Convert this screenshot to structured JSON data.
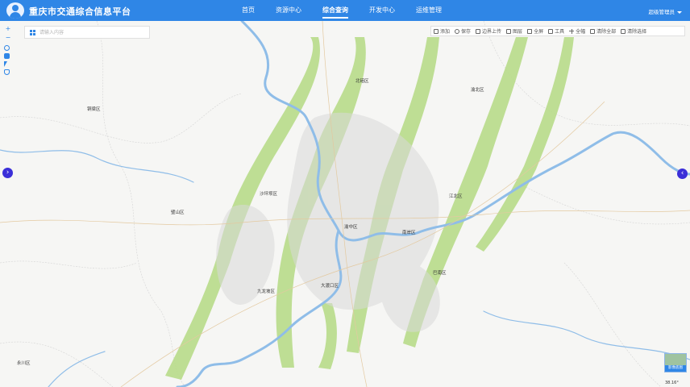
{
  "header": {
    "app_title": "重庆市交通综合信息平台",
    "nav": [
      "首页",
      "资源中心",
      "综合查询",
      "开发中心",
      "运维管理"
    ],
    "active_nav_index": 2,
    "user_label": "超级管理员",
    "bg_color": "#2f86e6"
  },
  "search": {
    "placeholder": "请输入内容",
    "icon": "grid-icon"
  },
  "map_controls": {
    "zoom_in": "+",
    "zoom_out": "−"
  },
  "toolbar": {
    "items": [
      {
        "label": "添加",
        "icon": "add-layer-icon"
      },
      {
        "label": "保存",
        "icon": "save-icon"
      },
      {
        "label": "边界上传",
        "icon": "upload-icon"
      },
      {
        "label": "图层",
        "icon": "layers-icon"
      },
      {
        "label": "全屏",
        "icon": "fullscreen-icon"
      },
      {
        "label": "工具",
        "icon": "tools-icon"
      },
      {
        "label": "全幅",
        "icon": "full-extent-icon"
      },
      {
        "label": "清除全部",
        "icon": "clear-all-icon"
      },
      {
        "label": "清除选择",
        "icon": "clear-selection-icon"
      }
    ]
  },
  "map_labels": {
    "beibei": "北碚区",
    "yubei": "渝北区",
    "tongliang": "铜梁区",
    "bishan": "璧山区",
    "shapingba": "沙坪坝区",
    "jiangbei": "江北区",
    "yuzhong": "渝中区",
    "nanan": "南岸区",
    "banan": "巴南区",
    "jiulongpo": "九龙坡区",
    "dadukou": "大渡口区",
    "yongchuan": "永川区"
  },
  "basemap_switch": {
    "label": "影像底图"
  },
  "coordinates": "38.16°"
}
